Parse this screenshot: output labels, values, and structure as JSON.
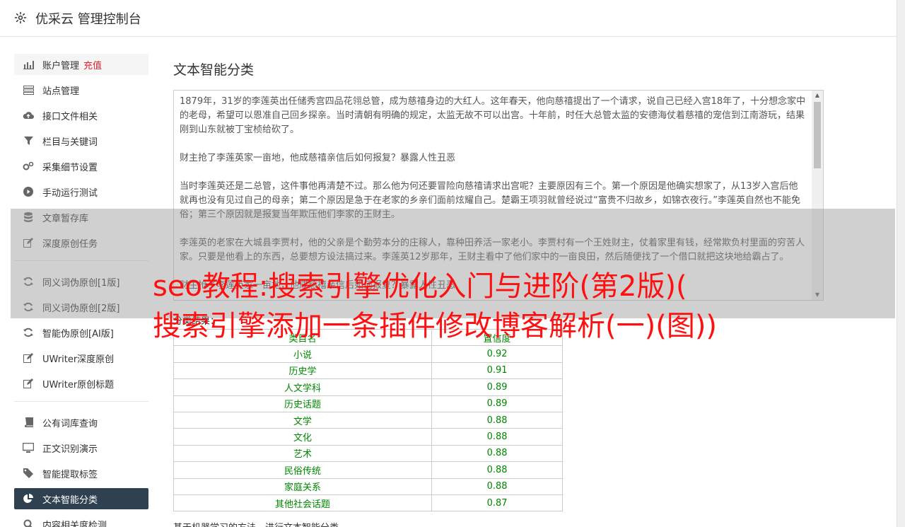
{
  "header": {
    "title": "优采云 管理控制台"
  },
  "sidebar": {
    "items": [
      {
        "label": "账户管理",
        "badge": "充值",
        "icon": "bar-chart-icon"
      },
      {
        "label": "站点管理",
        "icon": "server-icon"
      },
      {
        "label": "接口文件相关",
        "icon": "cloud-upload-icon"
      },
      {
        "label": "栏目与关键词",
        "icon": "filter-icon"
      },
      {
        "label": "采集细节设置",
        "icon": "gears-icon"
      },
      {
        "label": "手动运行测试",
        "icon": "play-circle-icon"
      },
      {
        "label": "文章暂存库",
        "icon": "database-icon"
      },
      {
        "label": "深度原创任务",
        "icon": "edit-icon"
      },
      {
        "label": "同义词伪原创[1版]",
        "icon": "refresh-icon"
      },
      {
        "label": "同义词伪原创[2版]",
        "icon": "refresh-icon"
      },
      {
        "label": "智能伪原创[AI版]",
        "icon": "refresh-icon"
      },
      {
        "label": "UWriter深度原创",
        "icon": "edit-icon"
      },
      {
        "label": "UWriter原创标题",
        "icon": "edit-icon"
      },
      {
        "label": "公有词库查询",
        "icon": "book-icon"
      },
      {
        "label": "正文识别演示",
        "icon": "monitor-icon"
      },
      {
        "label": "智能提取标签",
        "icon": "tag-icon"
      },
      {
        "label": "文本智能分类",
        "icon": "pie-chart-icon"
      },
      {
        "label": "内容相关度检测",
        "icon": "search-icon"
      }
    ]
  },
  "main": {
    "title": "文本智能分类",
    "text_paragraphs": [
      "1879年，31岁的李莲英出任储秀宫四品花翎总管，成为慈禧身边的大红人。这年春天，他向慈禧提出了一个请求，说自己已经入宫18年了，十分想念家中的老母，希望可以恩准自己回乡探亲。当时清朝有明确的规定，太监无故不可以出宫。十年前，时任大总管太监的安德海仗着慈禧的宠信到江南游玩，结果刚到山东就被丁宝桢给砍了。",
      "财主抢了李莲英家一亩地，他成慈禧亲信后如何报复？暴露人性丑恶",
      "当时李莲英还是二总管，这件事他再清楚不过。那么他为何还要冒险向慈禧请求出宫呢？主要原因有三个。第一个原因是他确实想家了，从13岁入宫后他就再也没有见过自己的母亲；第二个原因是急于在老家的乡亲们面前炫耀自己。楚霸王项羽就曾经说过“富贵不归故乡，如锦衣夜行。”李莲英自然也不能免俗；第三个原因就是报复当年欺压他们李家的王财主。",
      "李莲英的老家在大城县李贾村，他的父亲是个勤劳本分的庄稼人，靠种田养活一家老小。李贾村有一个王姓财主，仗着家里有钱，经常欺负村里面的穷苦人家。只要是他看上的东西，总要想方设法搞过来。李莲英12岁那年，王财主看中了他们家中的一亩良田，然后随便找了一个借口就把这块地给霸占了。",
      "财主抢了李莲英家一亩地，他成慈禧亲信后如何报复？暴露人性丑恶"
    ],
    "result_label": "分类结果：",
    "table": {
      "headers": [
        "类目名",
        "置信度"
      ],
      "rows": [
        [
          "小说",
          "0.92"
        ],
        [
          "历史学",
          "0.91"
        ],
        [
          "人文学科",
          "0.89"
        ],
        [
          "历史话题",
          "0.89"
        ],
        [
          "文学",
          "0.88"
        ],
        [
          "文化",
          "0.88"
        ],
        [
          "艺术",
          "0.88"
        ],
        [
          "民俗传统",
          "0.88"
        ],
        [
          "家庭关系",
          "0.88"
        ],
        [
          "其他社会话题",
          "0.87"
        ]
      ]
    },
    "description": "基于机器学习的方法，进行文本智能分类。"
  },
  "overlay": {
    "line1": "seo教程:搜索引擎优化入门与进阶(第2版)(",
    "line2": "搜索引擎添加一条插件修改博客解析(一)(图))"
  },
  "colors": {
    "active_bg": "#2f4050",
    "badge": "#e0242c",
    "table_text": "#008800",
    "overlay_text": "#ff1010"
  }
}
